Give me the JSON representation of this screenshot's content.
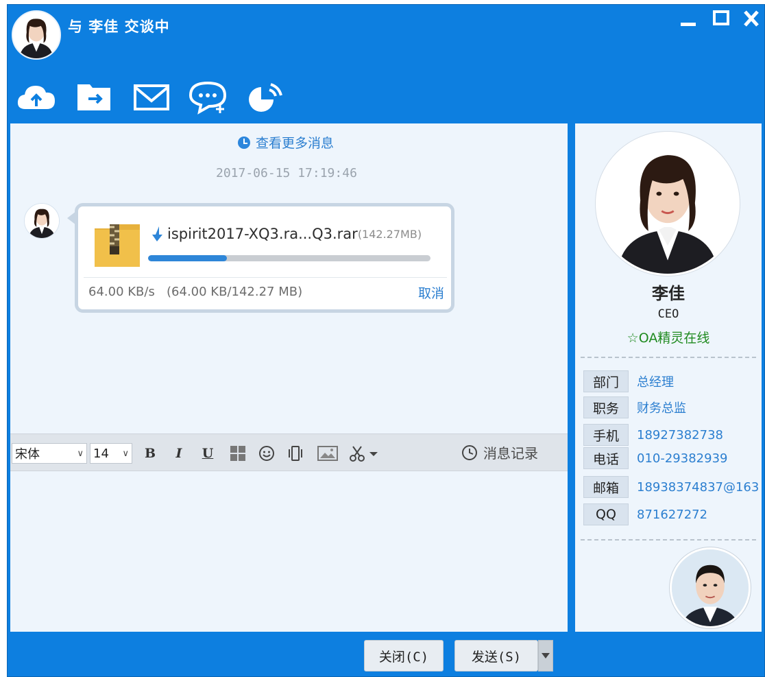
{
  "window": {
    "title": "与 李佳 交谈中",
    "controls": [
      "minimize",
      "maximize",
      "close"
    ]
  },
  "toolbar": {
    "icons": [
      "upload-cloud-icon",
      "send-file-icon",
      "mail-icon",
      "add-chat-icon",
      "pie-chart-icon"
    ]
  },
  "chat": {
    "more_messages": "查看更多消息",
    "timestamp": "2017-06-15 17:19:46",
    "file_transfer": {
      "file_name": "ispirit2017-XQ3.ra...Q3.rar",
      "file_size": "(142.27MB)",
      "progress": 0.28,
      "speed": "64.00 KB/s",
      "transferred": "(64.00 KB/142.27 MB)",
      "cancel_label": "取消"
    }
  },
  "format_bar": {
    "font_family": "宋体",
    "font_size": "14",
    "bold": "B",
    "italic": "I",
    "underline": "U",
    "history_label": "消息记录"
  },
  "input": {
    "value": ""
  },
  "profile": {
    "name": "李佳",
    "title": "CEO",
    "status": "☆OA精灵在线",
    "fields": [
      {
        "label": "部门",
        "value": "总经理"
      },
      {
        "label": "职务",
        "value": "财务总监"
      },
      {
        "label": "手机",
        "value": "18927382738"
      },
      {
        "label": "电话",
        "value": "010-29382939"
      },
      {
        "label": "邮箱",
        "value": "18938374837@163…"
      },
      {
        "label": "QQ",
        "value": "871627272"
      }
    ]
  },
  "actions": {
    "close_label": "关闭(C)",
    "send_label": "发送(S)"
  },
  "colors": {
    "frame": "#0d7fe0",
    "accent": "#2c7fd0",
    "status_online": "#1f8a1f"
  }
}
